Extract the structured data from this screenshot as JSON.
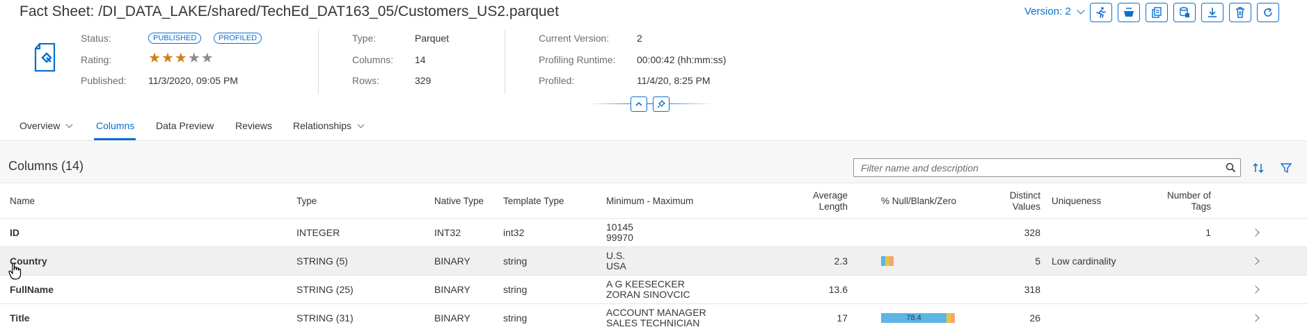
{
  "header": {
    "title": "Fact Sheet: /DI_DATA_LAKE/shared/TechEd_DAT163_05/Customers_US2.parquet",
    "version_label": "Version: 2",
    "toolbar_icons": [
      "run-icon",
      "bowl-icon",
      "copy-icon",
      "database-copy-icon",
      "download-icon",
      "delete-icon",
      "refresh-icon"
    ],
    "file_icon": "document-icon"
  },
  "summary": {
    "status_label": "Status:",
    "status_badges": [
      "PUBLISHED",
      "PROFILED"
    ],
    "rating_label": "Rating:",
    "rating_value": 3,
    "rating_max": 5,
    "published_label": "Published:",
    "published_value": "11/3/2020, 09:05 PM",
    "type_label": "Type:",
    "type_value": "Parquet",
    "columns_label": "Columns:",
    "columns_value": "14",
    "rows_label": "Rows:",
    "rows_value": "329",
    "current_version_label": "Current Version:",
    "current_version_value": "2",
    "profiling_runtime_label": "Profiling Runtime:",
    "profiling_runtime_value": "00:00:42 (hh:mm:ss)",
    "profiled_label": "Profiled:",
    "profiled_value": "11/4/20, 8:25 PM"
  },
  "tabs": [
    {
      "label": "Overview",
      "has_menu": true,
      "active": false
    },
    {
      "label": "Columns",
      "has_menu": false,
      "active": true
    },
    {
      "label": "Data Preview",
      "has_menu": false,
      "active": false
    },
    {
      "label": "Reviews",
      "has_menu": false,
      "active": false
    },
    {
      "label": "Relationships",
      "has_menu": true,
      "active": false
    }
  ],
  "columns_section": {
    "title": "Columns (14)",
    "search_placeholder": "Filter name and description",
    "headers": {
      "name": "Name",
      "type": "Type",
      "native_type": "Native Type",
      "template_type": "Template Type",
      "min_max": "Minimum - Maximum",
      "avg_length_1": "Average",
      "avg_length_2": "Length",
      "null_blank_zero": "% Null/Blank/Zero",
      "distinct_1": "Distinct",
      "distinct_2": "Values",
      "uniqueness": "Uniqueness",
      "tags_1": "Number of",
      "tags_2": "Tags"
    },
    "rows": [
      {
        "name": "ID",
        "type": "INTEGER",
        "native_type": "INT32",
        "template_type": "int32",
        "min": "10145",
        "max": "99970",
        "avg_length": "",
        "null_bar": null,
        "distinct": "328",
        "uniqueness": "",
        "tags": "1"
      },
      {
        "name": "Country",
        "type": "STRING (5)",
        "native_type": "BINARY",
        "template_type": "string",
        "min": "U.S.",
        "max": "USA",
        "avg_length": "2.3",
        "null_bar": {
          "null": 0.8,
          "blank": 0.6,
          "zero": 0.6,
          "label": ""
        },
        "distinct": "5",
        "uniqueness": "Low cardinality",
        "tags": ""
      },
      {
        "name": "FullName",
        "type": "STRING (25)",
        "native_type": "BINARY",
        "template_type": "string",
        "min": "A G KEESECKER",
        "max": "ZORAN SINOVCIC",
        "avg_length": "13.6",
        "null_bar": null,
        "distinct": "318",
        "uniqueness": "",
        "tags": ""
      },
      {
        "name": "Title",
        "type": "STRING (31)",
        "native_type": "BINARY",
        "template_type": "string",
        "min": "ACCOUNT MANAGER",
        "max": "SALES TECHNICIAN",
        "avg_length": "17",
        "null_bar": {
          "null": 78.4,
          "blank": 0.8,
          "zero": 0.8,
          "label": "78.4"
        },
        "distinct": "26",
        "uniqueness": "",
        "tags": ""
      }
    ]
  },
  "colors": {
    "accent": "#0a6ed1",
    "star_on": "#d08014",
    "bar_null": "#5cb5e5",
    "bar_blank": "#e8c14a",
    "bar_zero": "#f0a868"
  }
}
